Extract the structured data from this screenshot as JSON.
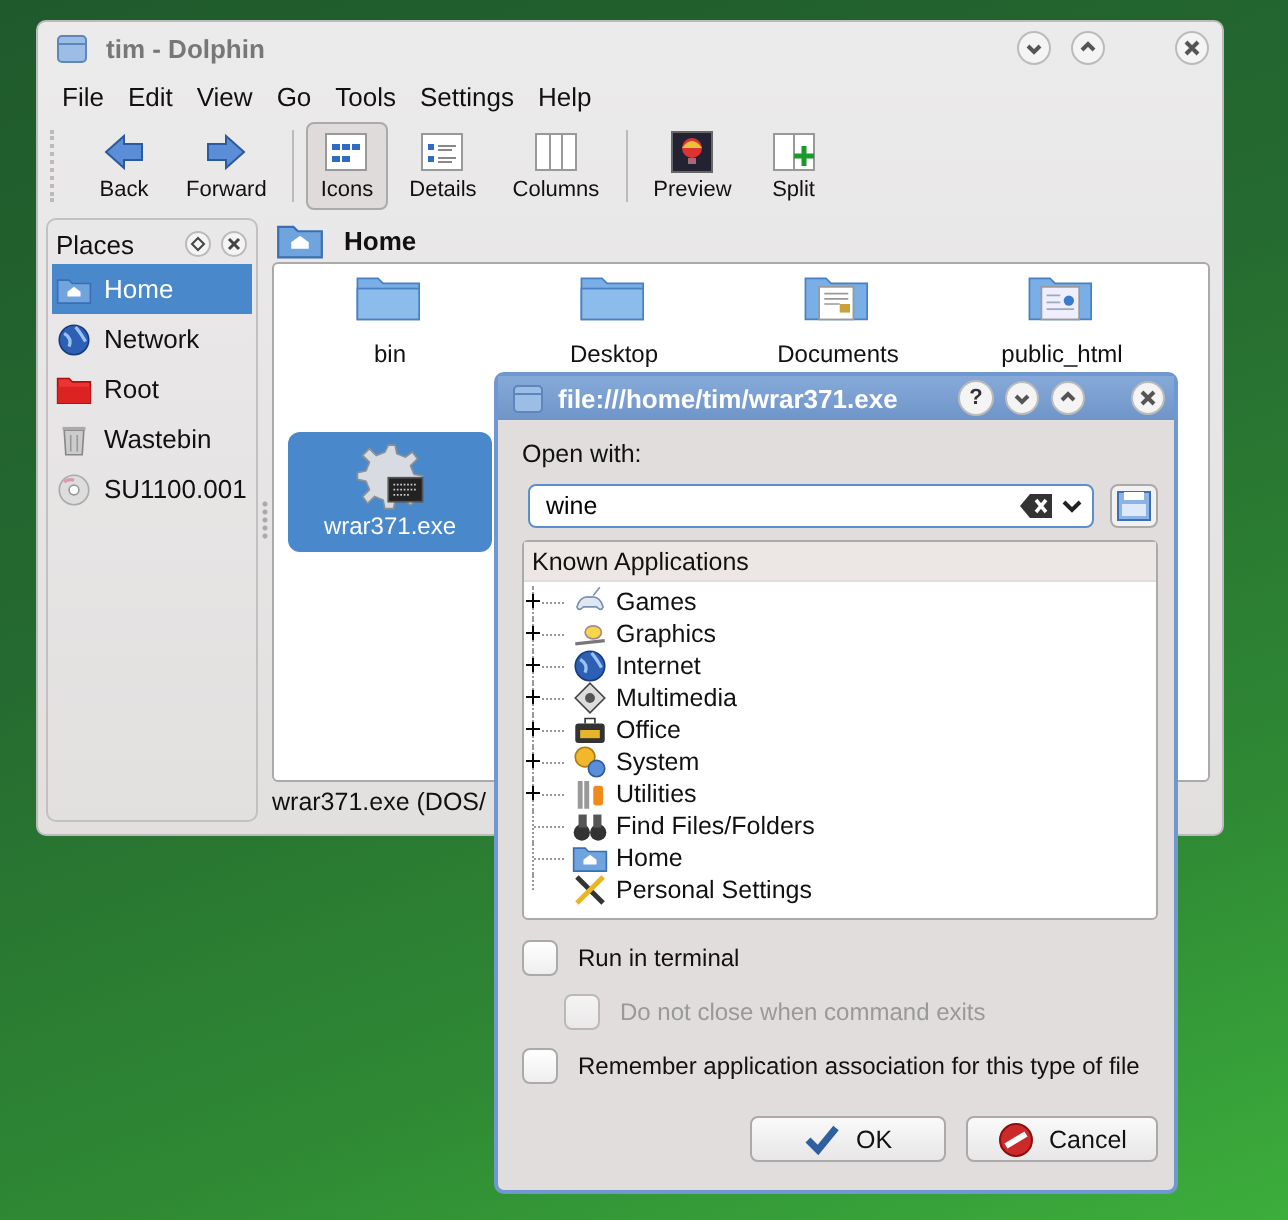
{
  "window": {
    "title": "tim - Dolphin"
  },
  "menu": [
    "File",
    "Edit",
    "View",
    "Go",
    "Tools",
    "Settings",
    "Help"
  ],
  "toolbar": [
    {
      "label": "Back",
      "selected": false
    },
    {
      "label": "Forward",
      "selected": false
    },
    {
      "label": "Icons",
      "selected": true
    },
    {
      "label": "Details",
      "selected": false
    },
    {
      "label": "Columns",
      "selected": false
    },
    {
      "label": "Preview",
      "selected": false
    },
    {
      "label": "Split",
      "selected": false
    }
  ],
  "places": {
    "title": "Places",
    "items": [
      {
        "label": "Home",
        "selected": true
      },
      {
        "label": "Network",
        "selected": false
      },
      {
        "label": "Root",
        "selected": false
      },
      {
        "label": "Wastebin",
        "selected": false
      },
      {
        "label": "SU1100.001",
        "selected": false
      }
    ]
  },
  "location": {
    "title": "Home"
  },
  "files": [
    {
      "name": "bin",
      "selected": false
    },
    {
      "name": "Desktop",
      "selected": false
    },
    {
      "name": "Documents",
      "selected": false
    },
    {
      "name": "public_html",
      "selected": false
    },
    {
      "name": "wrar371.exe",
      "selected": true
    }
  ],
  "status_bar": "wrar371.exe (DOS/",
  "dialog": {
    "title": "file:///home/tim/wrar371.exe",
    "help": "?",
    "prompt": "Open with:",
    "command": "wine",
    "tree": {
      "header": "Known Applications",
      "items": [
        {
          "label": "Games",
          "kind": "group"
        },
        {
          "label": "Graphics",
          "kind": "group"
        },
        {
          "label": "Internet",
          "kind": "group"
        },
        {
          "label": "Multimedia",
          "kind": "group"
        },
        {
          "label": "Office",
          "kind": "group"
        },
        {
          "label": "System",
          "kind": "group"
        },
        {
          "label": "Utilities",
          "kind": "group"
        },
        {
          "label": "Find Files/Folders",
          "kind": "app"
        },
        {
          "label": "Home",
          "kind": "app"
        },
        {
          "label": "Personal Settings",
          "kind": "app"
        }
      ]
    },
    "options": [
      {
        "label": "Run in terminal",
        "checked": false,
        "disabled": false,
        "children": [
          {
            "label": "Do not close when command exits",
            "checked": false,
            "disabled": true
          }
        ]
      },
      {
        "label": "Remember application association for this type of file",
        "checked": false,
        "disabled": false
      }
    ],
    "buttons": [
      {
        "label": "OK",
        "kind": "ok"
      },
      {
        "label": "Cancel",
        "kind": "cancel"
      }
    ]
  }
}
